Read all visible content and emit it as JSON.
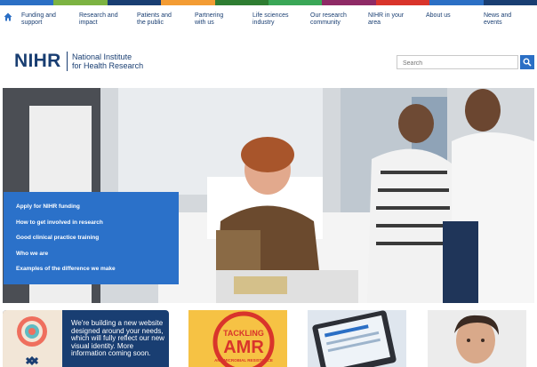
{
  "strip_colors": [
    "#2b6fc5",
    "#7cb342",
    "#193e72",
    "#f39c34",
    "#2e7d32",
    "#3aa757",
    "#8e2a66",
    "#d9342b",
    "#2b6fc5",
    "#193e72"
  ],
  "nav": {
    "home_icon": "home-icon",
    "items": [
      {
        "label": "Funding and\nsupport"
      },
      {
        "label": "Research and\nimpact"
      },
      {
        "label": "Patients and\nthe public"
      },
      {
        "label": "Partnering\nwith us"
      },
      {
        "label": "Life sciences\nindustry"
      },
      {
        "label": "Our research\ncommunity"
      },
      {
        "label": "NIHR in your\narea"
      },
      {
        "label": "About us"
      },
      {
        "label": "News and\nevents"
      }
    ]
  },
  "header": {
    "logo_text": "NIHR",
    "logo_subtitle": "National Institute\nfor Health Research",
    "search_placeholder": "Search",
    "search_icon": "search-icon"
  },
  "hero": {
    "links": [
      {
        "label": "Apply for NIHR funding"
      },
      {
        "label": "How to get involved in research"
      },
      {
        "label": "Good clinical practice training"
      },
      {
        "label": "Who we are"
      },
      {
        "label": "Examples of the difference we make"
      }
    ]
  },
  "tiles": {
    "promo_text": "We're building a new website designed around your needs, which will fully reflect our new visual identity. More information coming soon.",
    "amr_line1": "TACKLING",
    "amr_line2": "AMR",
    "amr_line3": "ANTIMICROBIAL RESISTANCE"
  },
  "colors": {
    "brand": "#193e72",
    "accent": "#2b71c9",
    "amr_yellow": "#f6c244",
    "amr_red": "#d9342b"
  }
}
